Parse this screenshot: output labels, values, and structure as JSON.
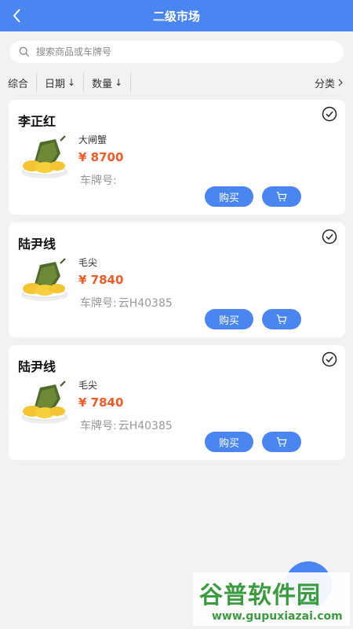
{
  "header": {
    "title": "二级市场",
    "back_icon": "back-chevron-icon"
  },
  "search": {
    "placeholder": "搜索商品或车牌号",
    "value": ""
  },
  "filters": {
    "items": [
      {
        "label": "综合",
        "arrow": ""
      },
      {
        "label": "日期",
        "arrow": "↓"
      },
      {
        "label": "数量",
        "arrow": "↓"
      }
    ],
    "category_label": "分类"
  },
  "listings": [
    {
      "seller": "李正红",
      "product": "大闸蟹",
      "price": "¥ 8700",
      "plate_label": "车牌号:",
      "plate_value": "",
      "buy_label": "购买"
    },
    {
      "seller": "陆尹线",
      "product": "毛尖",
      "price": "¥ 7840",
      "plate_label": "车牌号:",
      "plate_value": "云H40385",
      "buy_label": "购买"
    },
    {
      "seller": "陆尹线",
      "product": "毛尖",
      "price": "¥ 7840",
      "plate_label": "车牌号:",
      "plate_value": "云H40385",
      "buy_label": "购买"
    }
  ],
  "watermark": {
    "title": "谷普软件园",
    "url": "www.gupuxiazai.com"
  },
  "colors": {
    "primary": "#4a86f2",
    "price": "#f15a24",
    "watermark": "#3a9b3f"
  }
}
